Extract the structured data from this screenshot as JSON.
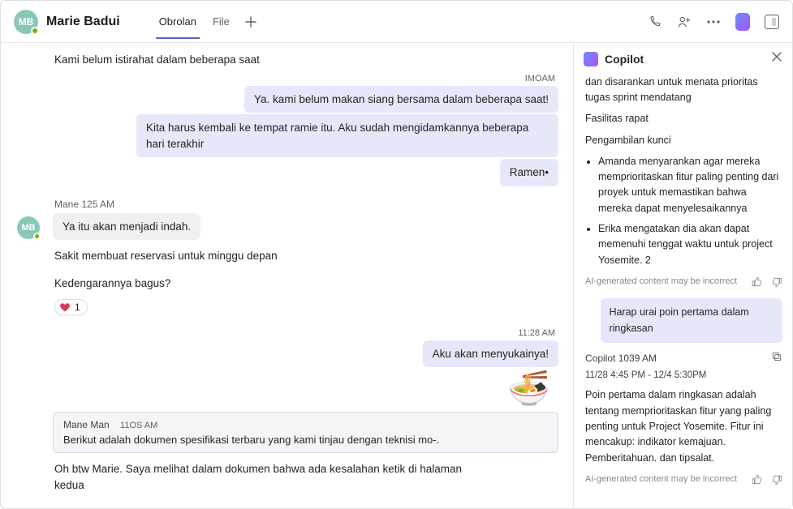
{
  "header": {
    "avatar_initials": "MB",
    "chat_name": "Marie Badui",
    "tabs": [
      {
        "label": "Obrolan",
        "active": true
      },
      {
        "label": "File",
        "active": false
      }
    ]
  },
  "chat": {
    "intro_line": "Kami belum istirahat dalam beberapa saat",
    "ts1": "IMOAM",
    "mine1": "Ya. kami belum makan siang bersama dalam beberapa saat!",
    "mine2": "Kita harus kembali ke tempat ramie itu. Aku sudah mengidamkannya beberapa hari terakhir",
    "mine3": "Ramen•",
    "other_sender_line": "Mane 125 AM",
    "other_avatar": "MB",
    "other1": "Ya itu akan menjadi indah.",
    "other2": "Sakit membuat reservasi untuk minggu depan",
    "other3": "Kedengarannya bagus?",
    "reaction_count": "1",
    "ts2": "11:28 AM",
    "mine4": "Aku akan menyukainya!",
    "noodle_emoji": "🍜",
    "quoted_sender": "Mane Man",
    "quoted_ts": "11OS AM",
    "quoted_body": "Berikut adalah dokumen spesifikasi terbaru yang kami tinjau dengan teknisi mo-.",
    "mine5": "Oh btw Marie. Saya melihat dalam dokumen bahwa ada kesalahan ketik di halaman kedua"
  },
  "copilot": {
    "title": "Copilot",
    "summary_p1": "dan disarankan untuk menata prioritas tugas sprint mendatang",
    "summary_p2": "Fasilitas rapat",
    "key_heading": "Pengambilan kunci",
    "bullets": [
      "Amanda menyarankan agar mereka memprioritaskan fitur paling penting dari proyek untuk memastikan bahwa mereka dapat menyelesaikannya",
      "Erika mengatakan dia akan dapat memenuhi tenggat waktu untuk project Yosemite. 2"
    ],
    "disclaimer": "AI-generated content may be incorrect",
    "user_q": "Harap urai poin pertama dalam ringkasan",
    "ans_header": "Copilot 1039 AM",
    "ans_range": "11/28 4:45 PM - 12/4 5:30PM",
    "ans_body": "Poin pertama dalam ringkasan adalah tentang memprioritaskan fitur yang paling penting untuk Project Yosemite. Fitur ini mencakup: indikator kemajuan. Pemberitahuan. dan tipsalat."
  }
}
